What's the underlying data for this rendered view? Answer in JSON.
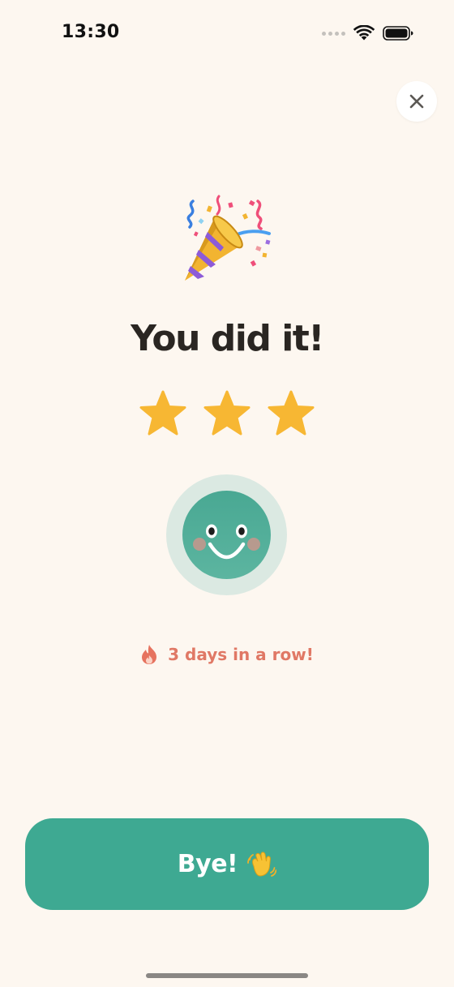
{
  "status_bar": {
    "time": "13:30",
    "icons": [
      "cellular-dots-icon",
      "wifi-icon",
      "battery-icon"
    ]
  },
  "close_button": {
    "icon": "close-icon"
  },
  "celebration": {
    "icon": "party-popper-icon",
    "title": "You did it!",
    "stars_earned": 3,
    "stars_total": 3,
    "star_color": "#f7b733"
  },
  "mascot": {
    "icon": "smiley-face-icon",
    "face_color": "#4aa993",
    "ring_color": "#dbe9e2"
  },
  "streak": {
    "icon": "fire-icon",
    "text": "3 days in a row!",
    "color": "#e07865"
  },
  "primary_button": {
    "label": "Bye!",
    "icon": "waving-hand-icon",
    "color": "#3ea992"
  }
}
